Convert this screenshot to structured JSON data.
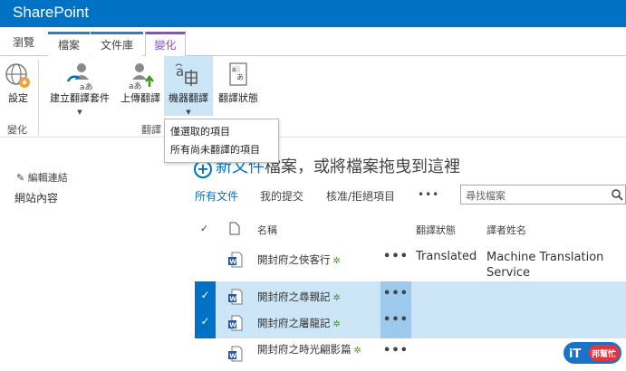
{
  "app": {
    "title": "SharePoint"
  },
  "tabs": [
    "瀏覽",
    "檔案",
    "文件庫",
    "變化"
  ],
  "ribbon": {
    "settings": {
      "label": "設定"
    },
    "create": {
      "label": "建立翻譯套件"
    },
    "upload": {
      "label": "上傳翻譯"
    },
    "machine_translation": {
      "label": "機器翻譯"
    },
    "status": {
      "label": "翻譯狀態"
    },
    "groups": [
      "變化",
      "翻譯"
    ]
  },
  "menu": {
    "items": [
      "僅選取的項目",
      "所有尚未翻譯的項目"
    ]
  },
  "left_nav": {
    "edit_links": "編輯連結",
    "site_contents": "網站內容"
  },
  "new_document": {
    "link": "新文件",
    "rest": "檔案，或將檔案拖曳到這裡"
  },
  "views": {
    "items": [
      "所有文件",
      "我的提交",
      "核准/拒絕項目",
      "•••"
    ]
  },
  "search": {
    "placeholder": "尋找檔案"
  },
  "list": {
    "headers": {
      "check": "✓",
      "name": "名稱",
      "state": "翻譯狀態",
      "translator": "譯者姓名"
    },
    "rows": [
      {
        "name": "開封府之俠客行",
        "state": "Translated",
        "translator": "Machine Translation Service",
        "selected": false
      },
      {
        "name": "開封府之尋親記",
        "state": "",
        "translator": "",
        "selected": true
      },
      {
        "name": "開封府之屠龍記",
        "state": "",
        "translator": "",
        "selected": true
      },
      {
        "name": "開封府之時光翩影篇",
        "state": "",
        "translator": "",
        "selected": false
      }
    ],
    "row_actions": "•••",
    "new_marker": "✲"
  },
  "watermark": {
    "text": "iT邦幫忙"
  },
  "colors": {
    "brand": "#0072c6",
    "selection": "#cde6f7",
    "translate_tab": "#8a4fc8"
  }
}
